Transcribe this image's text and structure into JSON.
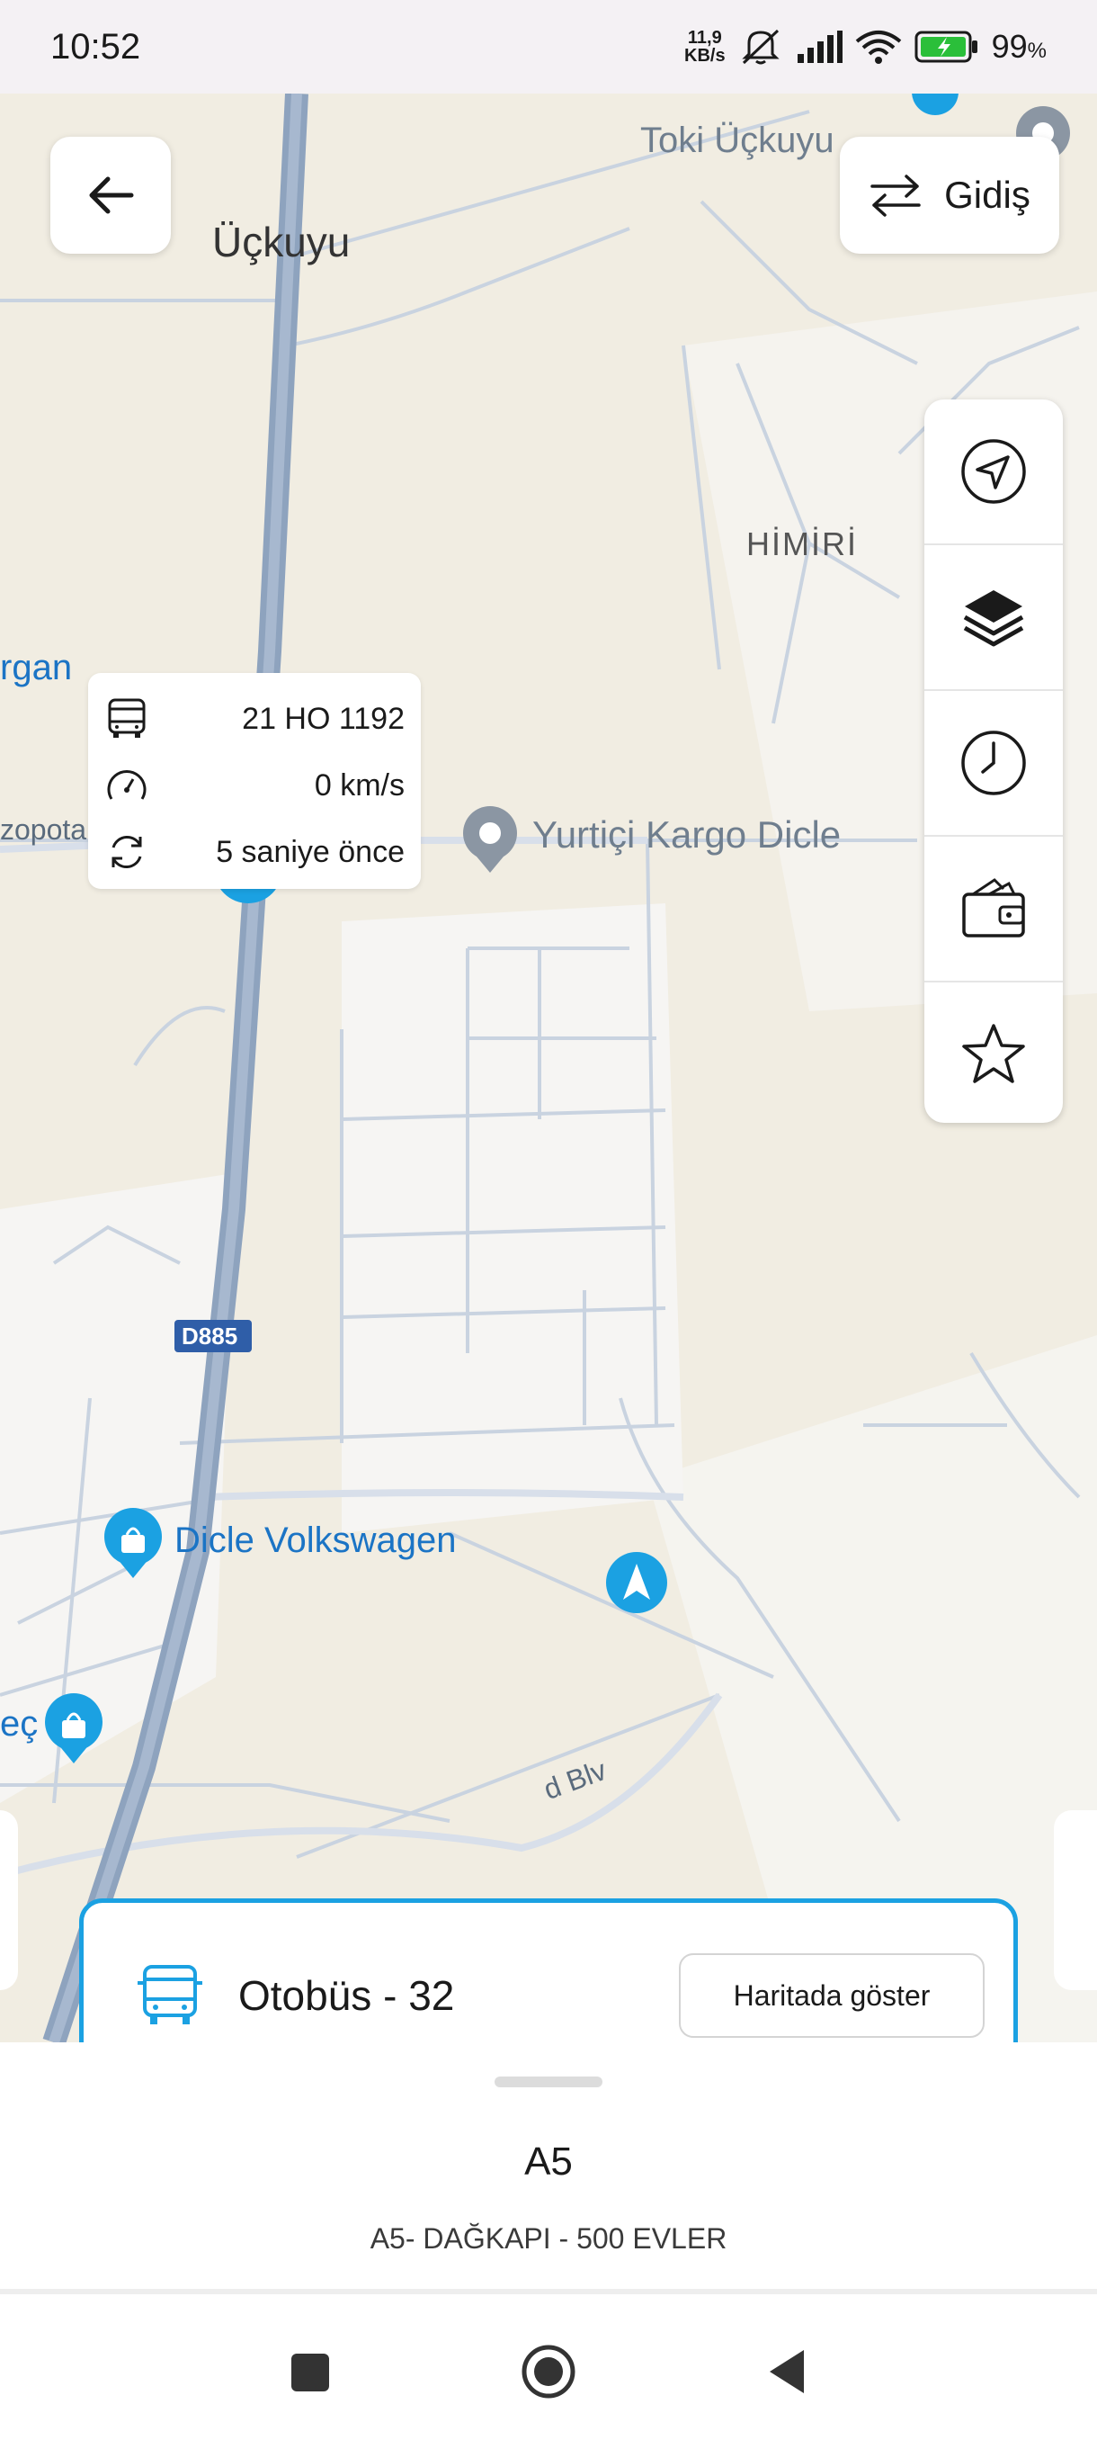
{
  "status_bar": {
    "time": "10:52",
    "net_speed_value": "11,9",
    "net_speed_unit": "KB/s",
    "battery_percent": "99",
    "battery_unit": "%"
  },
  "map": {
    "labels": {
      "uckuyu": "Üçkuyu",
      "toki": "Toki Üçkuyu",
      "himiri": "HİMİRİ",
      "ergani_fragment": "rgan",
      "mezopotamya": "zopotamya Blv",
      "yurtici": "Yurtiçi Kargo Dicle",
      "road_shield": "D885",
      "dicle_vw": "Dicle Volkswagen",
      "ec_fragment": "eç",
      "blv_fragment": "d Blv"
    }
  },
  "top_right_button": {
    "label": "Gidiş"
  },
  "vehicle_popup": {
    "plate": "21 HO 1192",
    "speed": "0 km/s",
    "updated": "5 saniye önce"
  },
  "bus_card": {
    "title": "Otobüs - 32",
    "show_on_map": "Haritada göster"
  },
  "bottom_sheet": {
    "route_code": "A5",
    "route_name": "A5- DAĞKAPI - 500 EVLER"
  },
  "colors": {
    "accent": "#1ba1e2",
    "map_bg": "#f1ede2",
    "road": "#c9d3e0",
    "highway": "#8ea3be"
  }
}
